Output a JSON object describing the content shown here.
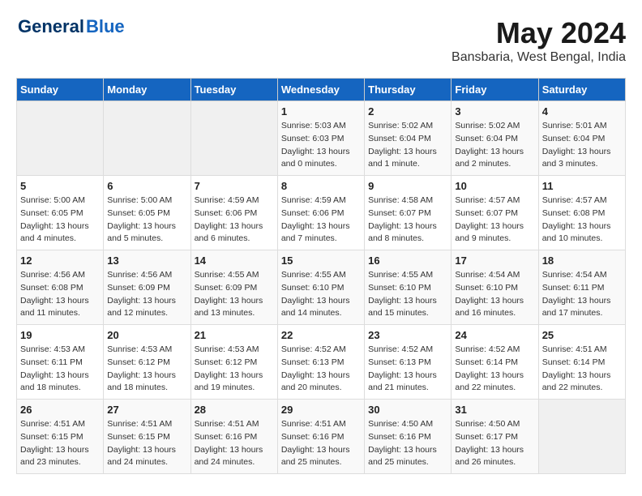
{
  "header": {
    "logo_general": "General",
    "logo_blue": "Blue",
    "month": "May 2024",
    "location": "Bansbaria, West Bengal, India"
  },
  "weekdays": [
    "Sunday",
    "Monday",
    "Tuesday",
    "Wednesday",
    "Thursday",
    "Friday",
    "Saturday"
  ],
  "weeks": [
    [
      {
        "day": "",
        "info": ""
      },
      {
        "day": "",
        "info": ""
      },
      {
        "day": "",
        "info": ""
      },
      {
        "day": "1",
        "info": "Sunrise: 5:03 AM\nSunset: 6:03 PM\nDaylight: 13 hours\nand 0 minutes."
      },
      {
        "day": "2",
        "info": "Sunrise: 5:02 AM\nSunset: 6:04 PM\nDaylight: 13 hours\nand 1 minute."
      },
      {
        "day": "3",
        "info": "Sunrise: 5:02 AM\nSunset: 6:04 PM\nDaylight: 13 hours\nand 2 minutes."
      },
      {
        "day": "4",
        "info": "Sunrise: 5:01 AM\nSunset: 6:04 PM\nDaylight: 13 hours\nand 3 minutes."
      }
    ],
    [
      {
        "day": "5",
        "info": "Sunrise: 5:00 AM\nSunset: 6:05 PM\nDaylight: 13 hours\nand 4 minutes."
      },
      {
        "day": "6",
        "info": "Sunrise: 5:00 AM\nSunset: 6:05 PM\nDaylight: 13 hours\nand 5 minutes."
      },
      {
        "day": "7",
        "info": "Sunrise: 4:59 AM\nSunset: 6:06 PM\nDaylight: 13 hours\nand 6 minutes."
      },
      {
        "day": "8",
        "info": "Sunrise: 4:59 AM\nSunset: 6:06 PM\nDaylight: 13 hours\nand 7 minutes."
      },
      {
        "day": "9",
        "info": "Sunrise: 4:58 AM\nSunset: 6:07 PM\nDaylight: 13 hours\nand 8 minutes."
      },
      {
        "day": "10",
        "info": "Sunrise: 4:57 AM\nSunset: 6:07 PM\nDaylight: 13 hours\nand 9 minutes."
      },
      {
        "day": "11",
        "info": "Sunrise: 4:57 AM\nSunset: 6:08 PM\nDaylight: 13 hours\nand 10 minutes."
      }
    ],
    [
      {
        "day": "12",
        "info": "Sunrise: 4:56 AM\nSunset: 6:08 PM\nDaylight: 13 hours\nand 11 minutes."
      },
      {
        "day": "13",
        "info": "Sunrise: 4:56 AM\nSunset: 6:09 PM\nDaylight: 13 hours\nand 12 minutes."
      },
      {
        "day": "14",
        "info": "Sunrise: 4:55 AM\nSunset: 6:09 PM\nDaylight: 13 hours\nand 13 minutes."
      },
      {
        "day": "15",
        "info": "Sunrise: 4:55 AM\nSunset: 6:10 PM\nDaylight: 13 hours\nand 14 minutes."
      },
      {
        "day": "16",
        "info": "Sunrise: 4:55 AM\nSunset: 6:10 PM\nDaylight: 13 hours\nand 15 minutes."
      },
      {
        "day": "17",
        "info": "Sunrise: 4:54 AM\nSunset: 6:10 PM\nDaylight: 13 hours\nand 16 minutes."
      },
      {
        "day": "18",
        "info": "Sunrise: 4:54 AM\nSunset: 6:11 PM\nDaylight: 13 hours\nand 17 minutes."
      }
    ],
    [
      {
        "day": "19",
        "info": "Sunrise: 4:53 AM\nSunset: 6:11 PM\nDaylight: 13 hours\nand 18 minutes."
      },
      {
        "day": "20",
        "info": "Sunrise: 4:53 AM\nSunset: 6:12 PM\nDaylight: 13 hours\nand 18 minutes."
      },
      {
        "day": "21",
        "info": "Sunrise: 4:53 AM\nSunset: 6:12 PM\nDaylight: 13 hours\nand 19 minutes."
      },
      {
        "day": "22",
        "info": "Sunrise: 4:52 AM\nSunset: 6:13 PM\nDaylight: 13 hours\nand 20 minutes."
      },
      {
        "day": "23",
        "info": "Sunrise: 4:52 AM\nSunset: 6:13 PM\nDaylight: 13 hours\nand 21 minutes."
      },
      {
        "day": "24",
        "info": "Sunrise: 4:52 AM\nSunset: 6:14 PM\nDaylight: 13 hours\nand 22 minutes."
      },
      {
        "day": "25",
        "info": "Sunrise: 4:51 AM\nSunset: 6:14 PM\nDaylight: 13 hours\nand 22 minutes."
      }
    ],
    [
      {
        "day": "26",
        "info": "Sunrise: 4:51 AM\nSunset: 6:15 PM\nDaylight: 13 hours\nand 23 minutes."
      },
      {
        "day": "27",
        "info": "Sunrise: 4:51 AM\nSunset: 6:15 PM\nDaylight: 13 hours\nand 24 minutes."
      },
      {
        "day": "28",
        "info": "Sunrise: 4:51 AM\nSunset: 6:16 PM\nDaylight: 13 hours\nand 24 minutes."
      },
      {
        "day": "29",
        "info": "Sunrise: 4:51 AM\nSunset: 6:16 PM\nDaylight: 13 hours\nand 25 minutes."
      },
      {
        "day": "30",
        "info": "Sunrise: 4:50 AM\nSunset: 6:16 PM\nDaylight: 13 hours\nand 25 minutes."
      },
      {
        "day": "31",
        "info": "Sunrise: 4:50 AM\nSunset: 6:17 PM\nDaylight: 13 hours\nand 26 minutes."
      },
      {
        "day": "",
        "info": ""
      }
    ]
  ]
}
